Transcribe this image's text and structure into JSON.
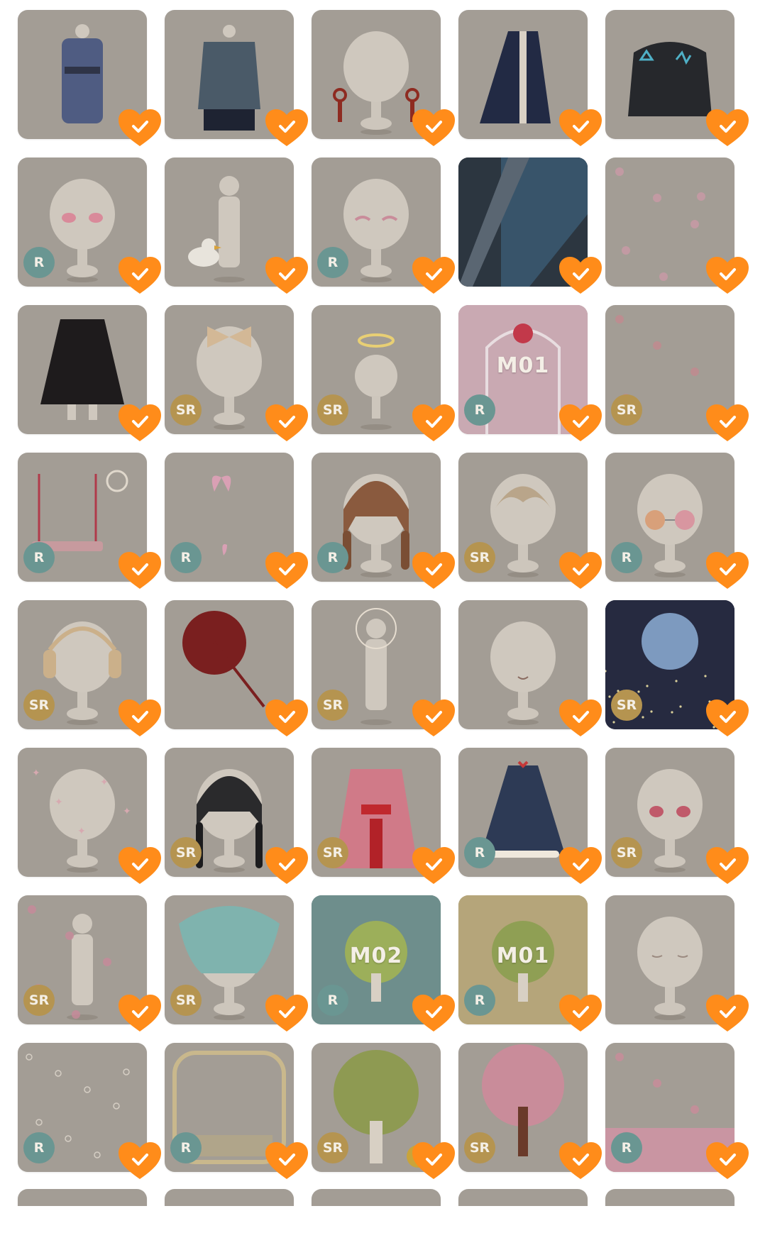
{
  "colors": {
    "favorite": "#ff8c1a",
    "badge_r": "#6a9692",
    "badge_sr": "#b59450",
    "tile": "#a39d95"
  },
  "items": [
    {
      "art": "kimono-dress",
      "rarity": null,
      "bg": "tile"
    },
    {
      "art": "hanfu-robe",
      "rarity": null,
      "bg": "tile"
    },
    {
      "art": "red-tassel-earrings",
      "rarity": null,
      "bg": "tile"
    },
    {
      "art": "navy-long-coat",
      "rarity": null,
      "bg": "tile"
    },
    {
      "art": "black-neon-sweater",
      "rarity": null,
      "bg": "tile"
    },
    {
      "art": "pink-eyes",
      "rarity": "R",
      "bg": "tile"
    },
    {
      "art": "duck-pet",
      "rarity": null,
      "bg": "tile"
    },
    {
      "art": "closed-eyes-makeup",
      "rarity": "R",
      "bg": "tile"
    },
    {
      "art": "space-window-background",
      "rarity": null,
      "bg": "dark"
    },
    {
      "art": "floating-petals",
      "rarity": null,
      "bg": "tile"
    },
    {
      "art": "black-skirt",
      "rarity": null,
      "bg": "tile"
    },
    {
      "art": "hair-bow",
      "rarity": "SR",
      "bg": "tile"
    },
    {
      "art": "halo",
      "rarity": "SR",
      "bg": "tile"
    },
    {
      "art": "music-stage-rose",
      "rarity": "R",
      "bg": "pink",
      "code": "M01"
    },
    {
      "art": "falling-petals",
      "rarity": "SR",
      "bg": "tile"
    },
    {
      "art": "flower-swing",
      "rarity": "R",
      "bg": "tile"
    },
    {
      "art": "butterflies",
      "rarity": "R",
      "bg": "tile"
    },
    {
      "art": "braided-brown-hair",
      "rarity": "R",
      "bg": "tile"
    },
    {
      "art": "short-blonde-hair",
      "rarity": "SR",
      "bg": "tile"
    },
    {
      "art": "gradient-sunglasses",
      "rarity": "R",
      "bg": "tile"
    },
    {
      "art": "headphones",
      "rarity": "SR",
      "bg": "tile"
    },
    {
      "art": "red-paper-umbrella",
      "rarity": null,
      "bg": "tile"
    },
    {
      "art": "light-aura",
      "rarity": "SR",
      "bg": "tile"
    },
    {
      "art": "smile-mouth",
      "rarity": null,
      "bg": "tile"
    },
    {
      "art": "full-moon-night",
      "rarity": "SR",
      "bg": "night"
    },
    {
      "art": "sparkles",
      "rarity": null,
      "bg": "tile"
    },
    {
      "art": "black-braided-hair",
      "rarity": "SR",
      "bg": "tile"
    },
    {
      "art": "pink-kimono",
      "rarity": "SR",
      "bg": "tile"
    },
    {
      "art": "navy-lolita-dress",
      "rarity": "R",
      "bg": "tile"
    },
    {
      "art": "red-eyes",
      "rarity": "SR",
      "bg": "tile"
    },
    {
      "art": "pink-aura",
      "rarity": "SR",
      "bg": "tile"
    },
    {
      "art": "teal-wavy-hair",
      "rarity": "SR",
      "bg": "tile"
    },
    {
      "art": "music-stage-tree",
      "rarity": "R",
      "bg": "teal",
      "code": "M02"
    },
    {
      "art": "music-stage-tree-gold",
      "rarity": "R",
      "bg": "gold",
      "code": "M01"
    },
    {
      "art": "sleepy-eyes",
      "rarity": null,
      "bg": "tile"
    },
    {
      "art": "bubbles",
      "rarity": "R",
      "bg": "tile"
    },
    {
      "art": "ornate-frame",
      "rarity": "R",
      "bg": "tile"
    },
    {
      "art": "money-tree",
      "rarity": "SR",
      "bg": "tile"
    },
    {
      "art": "cherry-blossom-tree",
      "rarity": "SR",
      "bg": "tile"
    },
    {
      "art": "blossom-ground",
      "rarity": "R",
      "bg": "tile"
    }
  ],
  "partial_row_count": 5
}
